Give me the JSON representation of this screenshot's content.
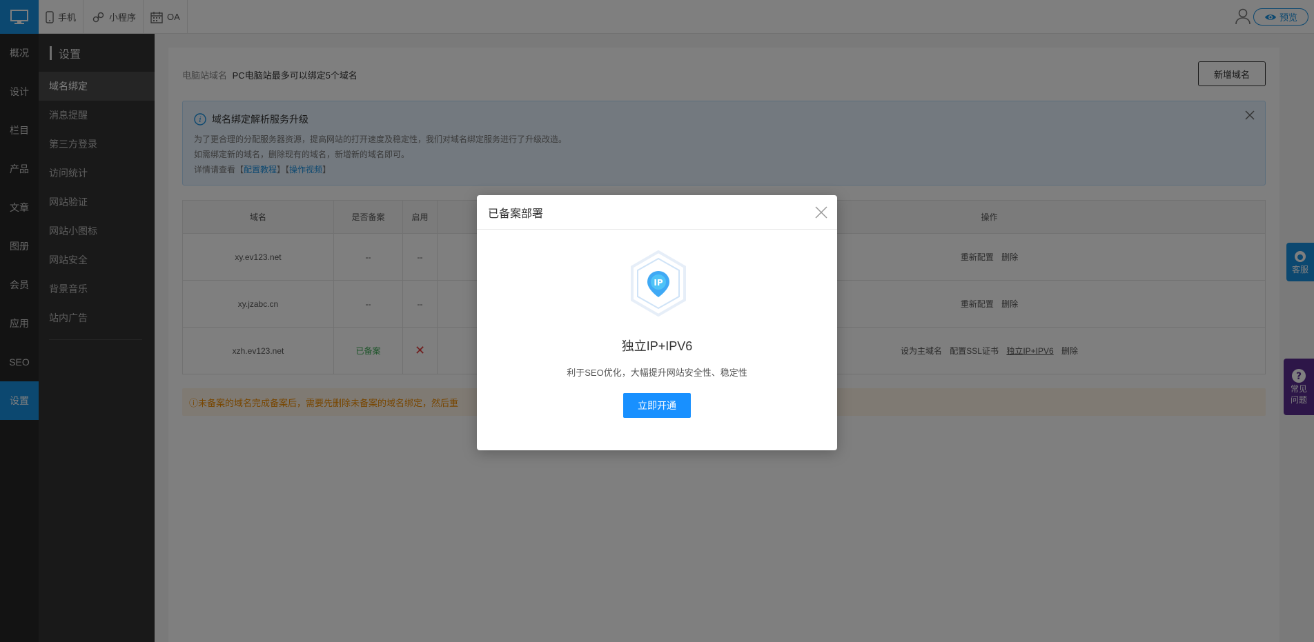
{
  "topbar": {
    "tabs": [
      {
        "label": "手机",
        "icon": "phone-icon"
      },
      {
        "label": "小程序",
        "icon": "miniprogram-icon"
      },
      {
        "label": "OA",
        "icon": "calendar-icon"
      }
    ],
    "preview_label": "预览"
  },
  "nav1": [
    "概况",
    "设计",
    "栏目",
    "产品",
    "文章",
    "图册",
    "会员",
    "应用",
    "SEO",
    "设置"
  ],
  "nav1_active": "设置",
  "nav2": {
    "title": "设置",
    "items": [
      "域名绑定",
      "消息提醒",
      "第三方登录",
      "访问统计",
      "网站验证",
      "网站小图标",
      "网站安全",
      "背景音乐",
      "站内广告"
    ],
    "active": "域名绑定"
  },
  "main": {
    "domain_label": "电脑站域名",
    "domain_hint": "PC电脑站最多可以绑定5个域名",
    "add_button": "新增域名",
    "notice": {
      "title": "域名绑定解析服务升级",
      "line1": "为了更合理的分配服务器资源，提高网站的打开速度及稳定性，我们对域名绑定服务进行了升级改造。",
      "line2": "如需绑定新的域名，删除现有的域名，新增新的域名即可。",
      "line3_prefix": "详情请查看【",
      "link1": "配置教程",
      "mid": "】【",
      "link2": "操作视频",
      "suffix": "】"
    },
    "table": {
      "headers": [
        "域名",
        "是否备案",
        "启用",
        "",
        "操作"
      ],
      "rows": [
        {
          "domain": "xy.ev123.net",
          "icp": "--",
          "enabled": "--",
          "ops": [
            "重新配置",
            "删除"
          ]
        },
        {
          "domain": "xy.jzabc.cn",
          "icp": "--",
          "enabled": "--",
          "ops": [
            "重新配置",
            "删除"
          ]
        },
        {
          "domain": "xzh.ev123.net",
          "icp": "已备案",
          "enabled": "✕",
          "ops": [
            "设为主域名",
            "配置SSL证书",
            "独立IP+IPV6",
            "删除"
          ]
        }
      ]
    },
    "warning": "ⓘ未备案的域名完成备案后，需要先删除未备案的域名绑定，然后重"
  },
  "float": {
    "service": "客服",
    "faq_line1": "常见",
    "faq_line2": "问题"
  },
  "modal": {
    "title": "已备案部署",
    "heading": "独立IP+IPV6",
    "desc": "利于SEO优化，大幅提升网站安全性、稳定性",
    "button": "立即开通",
    "icon_text": "IP"
  },
  "colors": {
    "accent": "#1890e0",
    "button": "#1890ff",
    "purple": "#5b2d90"
  }
}
